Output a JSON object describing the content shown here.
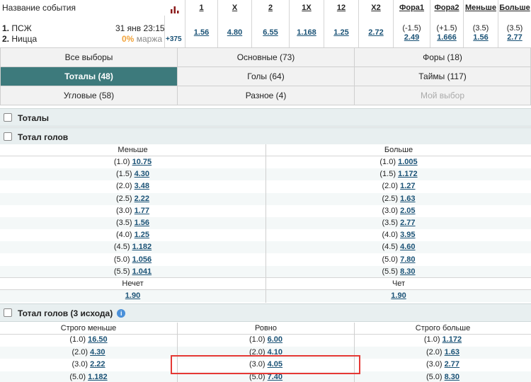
{
  "header": {
    "event_title": "Название события",
    "team1_num": "1.",
    "team1": "ПСЖ",
    "team2_num": "2.",
    "team2": "Ницца",
    "datetime": "31 янв 23:15",
    "margin_pct": "0%",
    "margin_label": "маржа",
    "more_markets": "+375",
    "markets": [
      {
        "label": "1",
        "value": "1.56"
      },
      {
        "label": "X",
        "value": "4.80"
      },
      {
        "label": "2",
        "value": "6.55"
      },
      {
        "label": "1X",
        "value": "1.168"
      },
      {
        "label": "12",
        "value": "1.25"
      },
      {
        "label": "X2",
        "value": "2.72"
      },
      {
        "label": "Фора1",
        "line": "(-1.5)",
        "value": "2.49"
      },
      {
        "label": "Фора2",
        "line": "(+1.5)",
        "value": "1.666"
      },
      {
        "label": "Меньше",
        "line": "(3.5)",
        "value": "1.56"
      },
      {
        "label": "Больше",
        "line": "(3.5)",
        "value": "2.77"
      }
    ]
  },
  "tabs": [
    {
      "label": "Все выборы"
    },
    {
      "label": "Основные (73)"
    },
    {
      "label": "Форы (18)"
    },
    {
      "label": "Тоталы (48)"
    },
    {
      "label": "Голы (64)"
    },
    {
      "label": "Таймы (117)"
    },
    {
      "label": "Угловые (58)"
    },
    {
      "label": "Разное (4)"
    },
    {
      "label": "Мой выбор"
    }
  ],
  "sections": {
    "totals": "Тоталы",
    "total_goals": "Тотал голов",
    "total_goals_3way": "Тотал голов (3 исхода)"
  },
  "total_goals": {
    "col_under": "Меньше",
    "col_over": "Больше",
    "under": [
      {
        "line": "(1.0)",
        "odd": "10.75"
      },
      {
        "line": "(1.5)",
        "odd": "4.30"
      },
      {
        "line": "(2.0)",
        "odd": "3.48"
      },
      {
        "line": "(2.5)",
        "odd": "2.22"
      },
      {
        "line": "(3.0)",
        "odd": "1.77"
      },
      {
        "line": "(3.5)",
        "odd": "1.56"
      },
      {
        "line": "(4.0)",
        "odd": "1.25"
      },
      {
        "line": "(4.5)",
        "odd": "1.182"
      },
      {
        "line": "(5.0)",
        "odd": "1.056"
      },
      {
        "line": "(5.5)",
        "odd": "1.041"
      }
    ],
    "over": [
      {
        "line": "(1.0)",
        "odd": "1.005"
      },
      {
        "line": "(1.5)",
        "odd": "1.172"
      },
      {
        "line": "(2.0)",
        "odd": "1.27"
      },
      {
        "line": "(2.5)",
        "odd": "1.63"
      },
      {
        "line": "(3.0)",
        "odd": "2.05"
      },
      {
        "line": "(3.5)",
        "odd": "2.77"
      },
      {
        "line": "(4.0)",
        "odd": "3.95"
      },
      {
        "line": "(4.5)",
        "odd": "4.60"
      },
      {
        "line": "(5.0)",
        "odd": "7.80"
      },
      {
        "line": "(5.5)",
        "odd": "8.30"
      }
    ],
    "odd_label": "Нечет",
    "odd_value": "1.90",
    "even_label": "Чет",
    "even_value": "1.90"
  },
  "total_goals_3way": {
    "col_under": "Строго меньше",
    "col_exact": "Ровно",
    "col_over": "Строго больше",
    "rows": [
      {
        "line": "(1.0)",
        "under": "16.50",
        "exact": "6.00",
        "over": "1.172"
      },
      {
        "line": "(2.0)",
        "under": "4.30",
        "exact": "4.10",
        "over": "1.63"
      },
      {
        "line": "(3.0)",
        "under": "2.22",
        "exact": "4.05",
        "over": "2.77"
      },
      {
        "line": "(5.0)",
        "under": "1.182",
        "exact": "7.40",
        "over": "8.30"
      }
    ]
  },
  "colors": {
    "accent": "#3d7a7c",
    "link": "#1a5276",
    "highlight": "#e53935",
    "margin": "#f2a33a"
  }
}
